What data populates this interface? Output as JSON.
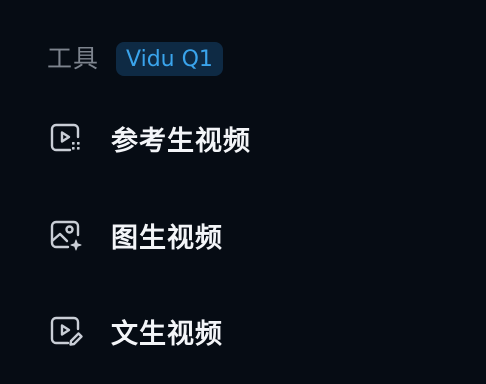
{
  "section": {
    "title": "工具",
    "badge": "Vidu Q1"
  },
  "menu": {
    "items": [
      {
        "label": "参考生视频",
        "icon": "video-play-grid-icon"
      },
      {
        "label": "图生视频",
        "icon": "image-sparkle-icon"
      },
      {
        "label": "文生视频",
        "icon": "video-play-edit-icon"
      }
    ]
  },
  "colors": {
    "background": "#060c14",
    "title": "#7d848e",
    "badge_bg": "#0e2a44",
    "badge_text": "#3aa4ec",
    "item_text": "#f3f5f8",
    "icon": "#c9ced6"
  }
}
